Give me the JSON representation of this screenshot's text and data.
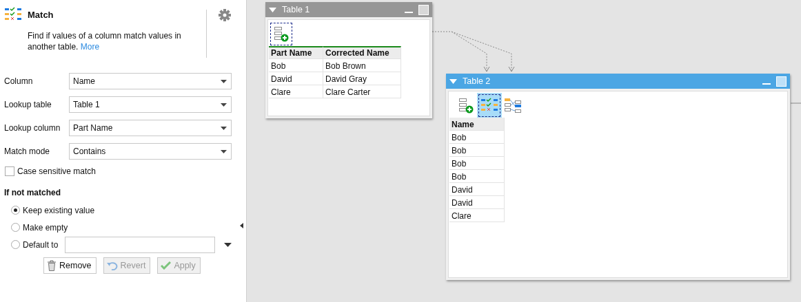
{
  "panel": {
    "title": "Match",
    "description": "Find if values of a column match values in another table.",
    "more_link": "More",
    "fields": [
      {
        "label": "Column",
        "value": "Name"
      },
      {
        "label": "Lookup table",
        "value": "Table 1"
      },
      {
        "label": "Lookup column",
        "value": "Part Name"
      },
      {
        "label": "Match mode",
        "value": "Contains"
      }
    ],
    "case_sensitive": {
      "label": "Case sensitive match",
      "checked": false
    },
    "if_not_matched": {
      "heading": "If not matched",
      "options": [
        {
          "label": "Keep existing value",
          "selected": true,
          "kind": "plain"
        },
        {
          "label": "Make empty",
          "selected": false,
          "kind": "plain"
        },
        {
          "label": "Default to",
          "selected": false,
          "kind": "input"
        }
      ]
    },
    "buttons": [
      {
        "label": "Remove",
        "kind": "remove",
        "disabled": false
      },
      {
        "label": "Revert",
        "kind": "revert",
        "disabled": true
      },
      {
        "label": "Apply",
        "kind": "apply",
        "disabled": true
      }
    ]
  },
  "canvas": {
    "windows": [
      {
        "title": "Table 1",
        "active": false,
        "tools": [
          {
            "kind": "add",
            "selected": true
          }
        ],
        "table": {
          "accent": true,
          "columns": [
            "Part Name",
            "Corrected Name"
          ],
          "rows": [
            [
              "Bob",
              "Bob Brown"
            ],
            [
              "David",
              "David Gray"
            ],
            [
              "Clare",
              "Clare Carter"
            ]
          ]
        }
      },
      {
        "title": "Table 2",
        "active": true,
        "tools": [
          {
            "kind": "add",
            "selected": false
          },
          {
            "kind": "match",
            "selected": true
          },
          {
            "kind": "map",
            "selected": false
          }
        ],
        "table": {
          "accent": false,
          "columns": [
            "Name"
          ],
          "rows": [
            [
              "Bob"
            ],
            [
              "Bob"
            ],
            [
              "Bob"
            ],
            [
              "Bob"
            ],
            [
              "David"
            ],
            [
              "David"
            ],
            [
              "Clare"
            ]
          ]
        }
      }
    ]
  }
}
